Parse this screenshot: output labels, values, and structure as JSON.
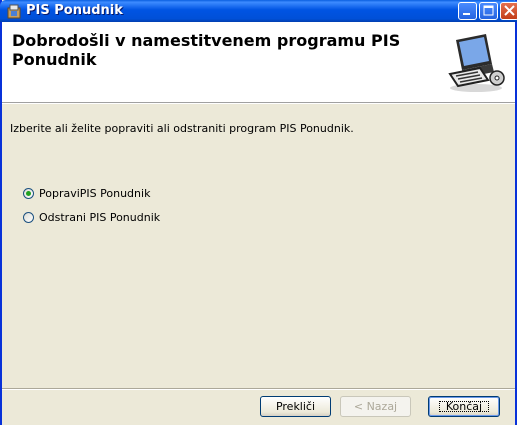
{
  "window": {
    "title": "PIS Ponudnik"
  },
  "banner": {
    "title": "Dobrodošli v namestitvenem programu PIS Ponudnik"
  },
  "prompt": "Izberite ali želite popraviti ali odstraniti program PIS Ponudnik.",
  "options": [
    {
      "label": "PopraviPIS Ponudnik",
      "checked": true
    },
    {
      "label": "Odstrani PIS Ponudnik",
      "checked": false
    }
  ],
  "buttons": {
    "cancel": "Prekliči",
    "back": "< Nazaj",
    "finish": "Končaj"
  }
}
